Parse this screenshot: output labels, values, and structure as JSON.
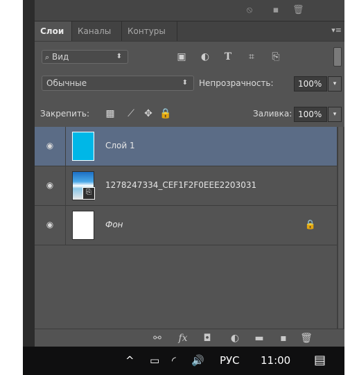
{
  "tabs": {
    "items": [
      {
        "label": "Слои",
        "active": true
      },
      {
        "label": "Каналы",
        "active": false
      },
      {
        "label": "Контуры",
        "active": false
      }
    ]
  },
  "filter": {
    "kind_label": "Вид",
    "search_icon": "search-icon",
    "icons": [
      "image-filter-icon",
      "adjustment-filter-icon",
      "type-filter-icon",
      "shape-filter-icon",
      "smart-object-filter-icon"
    ]
  },
  "blend": {
    "mode_label": "Обычные",
    "opacity_label": "Непрозрачность:",
    "opacity_value": "100%"
  },
  "lock": {
    "label": "Закрепить:",
    "icons": [
      "lock-transparency-icon",
      "lock-brush-icon",
      "lock-position-icon",
      "lock-all-icon"
    ],
    "fill_label": "Заливка:",
    "fill_value": "100%"
  },
  "layers": [
    {
      "name": "Слой 1",
      "selected": true,
      "visible": true
    },
    {
      "name": "1278247334_CEF1F2F0EEE2203031",
      "selected": false,
      "visible": true,
      "smart_object": true
    },
    {
      "name": "Фон",
      "selected": false,
      "visible": true,
      "locked": true,
      "italic": true
    }
  ],
  "bottom_icons": [
    "link-layers-icon",
    "fx-icon",
    "mask-icon",
    "adjustment-layer-icon",
    "folder-icon",
    "new-layer-icon",
    "trash-icon"
  ],
  "bottom": {
    "fx_label": "fx"
  },
  "taskbar": {
    "chevron": "^",
    "lang": "РУС",
    "time": "11:00"
  },
  "colors": {
    "panel": "#535353",
    "selected_layer": "#5b6c86",
    "layer1_thumb": "#00b7e7"
  }
}
